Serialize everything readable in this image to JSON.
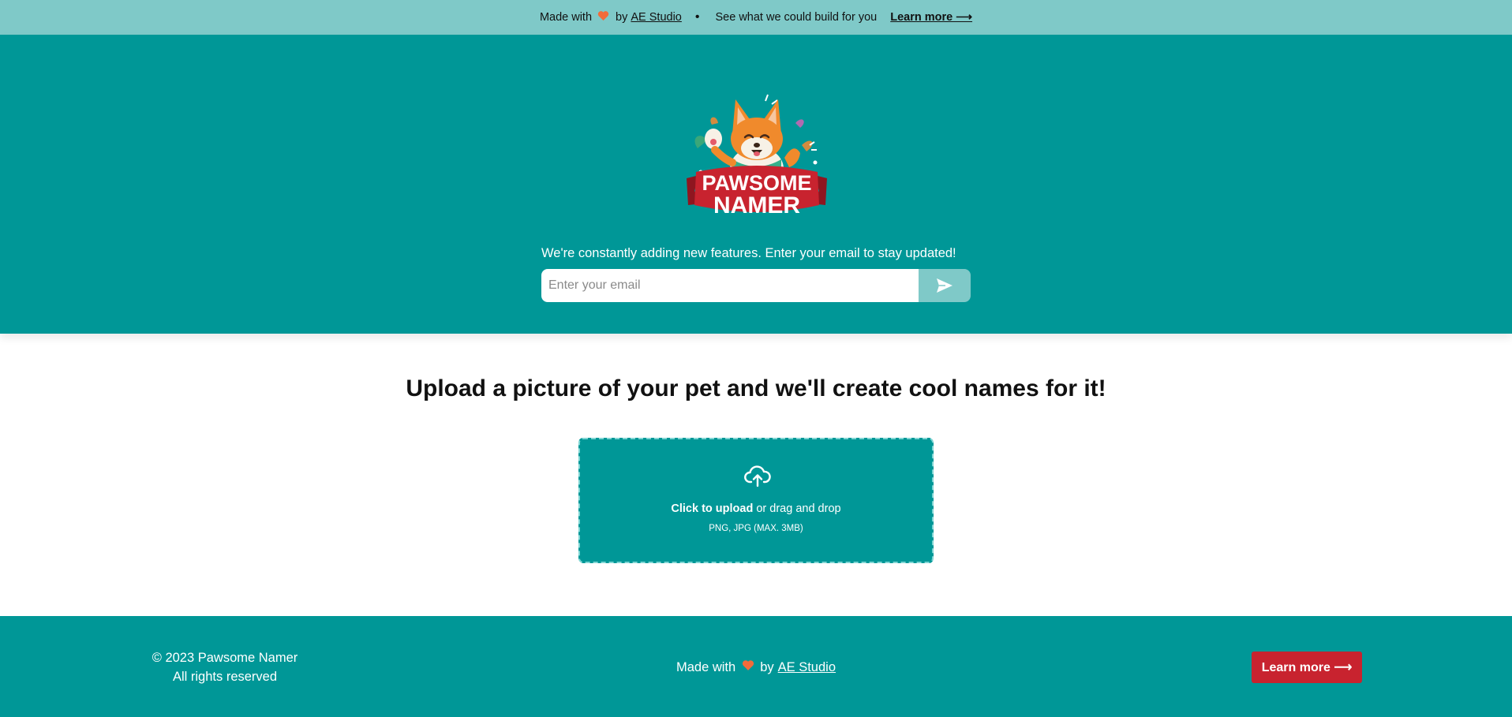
{
  "topbar": {
    "made_with": "Made with",
    "by": "by",
    "studio": "AE Studio",
    "separator": "•",
    "pitch": "See what we could build for you",
    "learn_more": "Learn more ⟶"
  },
  "hero": {
    "logo_line1": "PAWSOME",
    "logo_line2": "NAMER",
    "subscribe_text": "We're constantly adding new features. Enter your email to stay updated!",
    "email_placeholder": "Enter your email",
    "send_icon": "send-arrow-icon"
  },
  "main": {
    "headline": "Upload a picture of your pet and we'll create cool names for it!",
    "upload": {
      "icon": "cloud-upload-icon",
      "click_label": "Click to upload",
      "drag_label": " or drag and drop",
      "formats": "PNG, JPG (MAX. 3MB)"
    }
  },
  "footer": {
    "copyright": "© 2023 Pawsome Namer",
    "rights": "All rights reserved",
    "made_with": "Made with",
    "by": "by",
    "studio": "AE Studio",
    "learn_more": "Learn more ⟶"
  },
  "colors": {
    "primary_teal": "#009797",
    "light_teal": "#7fc9c8",
    "accent_red": "#c8232f",
    "heart_orange": "#f26b3a"
  }
}
